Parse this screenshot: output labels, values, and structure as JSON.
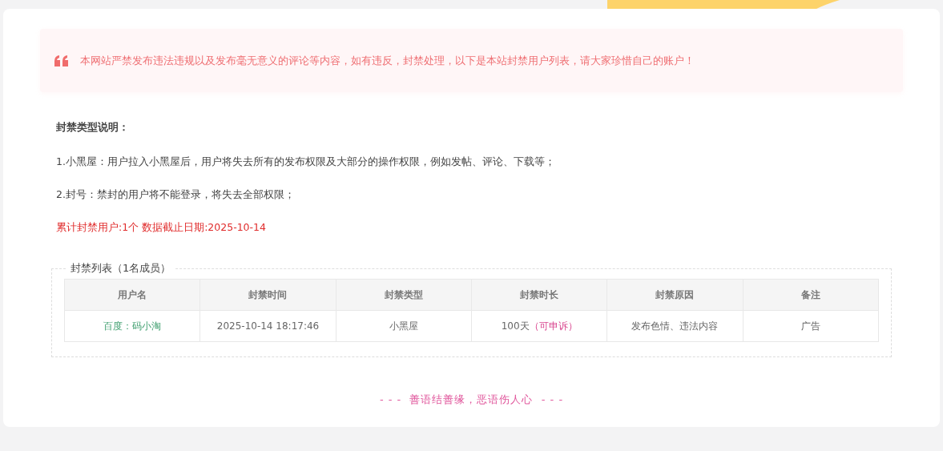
{
  "notice": {
    "text": "本网站严禁发布违法违规以及发布毫无意义的评论等内容，如有违反，封禁处理，以下是本站封禁用户列表，请大家珍惜自己的账户！"
  },
  "explanation": {
    "heading": "封禁类型说明：",
    "items": [
      "1.小黑屋：用户拉入小黑屋后，用户将失去所有的发布权限及大部分的操作权限，例如发帖、评论、下载等；",
      "2.封号：禁封的用户将不能登录，将失去全部权限；"
    ],
    "summary": "累计封禁用户:1个 数据截止日期:2025-10-14"
  },
  "ban_list": {
    "legend": "封禁列表（1名成员）",
    "columns": [
      "用户名",
      "封禁时间",
      "封禁类型",
      "封禁时长",
      "封禁原因",
      "备注"
    ],
    "rows": [
      {
        "username": "百度：码小淘",
        "time": "2025-10-14 18:17:46",
        "type": "小黑屋",
        "duration": "100天",
        "appeal": "（可申诉）",
        "reason": "发布色情、违法内容",
        "note": "广告"
      }
    ]
  },
  "footer": {
    "motto": "- - -  善语结善缘，恶语伤人心  - - -"
  }
}
